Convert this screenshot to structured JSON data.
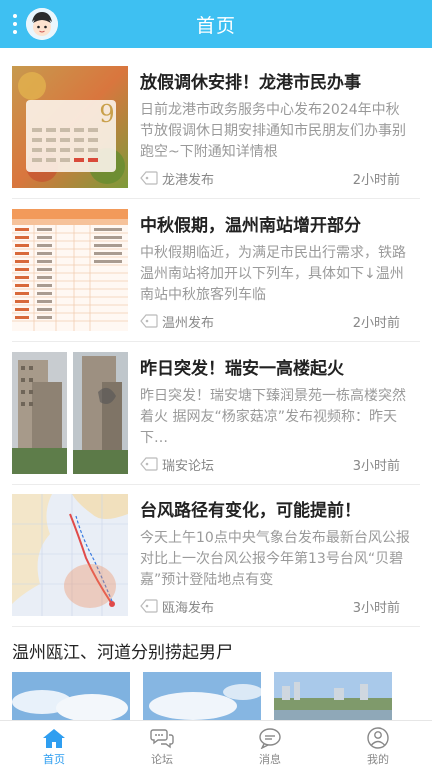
{
  "header": {
    "title": "首页"
  },
  "news": [
    {
      "title": "放假调休安排！龙港市民办事",
      "summary": "日前龙港市政务服务中心发布2024年中秋节放假调休日期安排通知市民朋友们办事别跑空~下附通知详情根",
      "source": "龙港发布",
      "time": "2小时前",
      "thumb": {
        "tag": "9"
      }
    },
    {
      "title": "中秋假期，温州南站增开部分",
      "summary": "中秋假期临近，为满足市民出行需求，铁路温州南站将加开以下列车，具体如下↓温州南站中秋旅客列车临",
      "source": "温州发布",
      "time": "2小时前"
    },
    {
      "title": "昨日突发！瑞安一高楼起火",
      "summary": "昨日突发！瑞安塘下臻润景苑一栋高楼突然着火 据网友“杨家菇凉”发布视频称：昨天下…",
      "source": "瑞安论坛",
      "time": "3小时前"
    },
    {
      "title": "台风路径有变化，可能提前！",
      "summary": "今天上午10点中央气象台发布最新台风公报对比上一次台风公报今年第13号台风“贝碧嘉”预计登陆地点有变",
      "source": "瓯海发布",
      "time": "3小时前"
    }
  ],
  "video_section": {
    "title": "温州瓯江、河道分别捞起男尸"
  },
  "tabbar": [
    {
      "label": "首页",
      "icon": "home-icon",
      "active": true
    },
    {
      "label": "论坛",
      "icon": "chat-bubbles-icon",
      "active": false
    },
    {
      "label": "消息",
      "icon": "message-icon",
      "active": false
    },
    {
      "label": "我的",
      "icon": "user-icon",
      "active": false
    }
  ],
  "colors": {
    "header": "#3ec0f2",
    "active_tab": "#2f9ef0",
    "secondary_text": "#9a9a9a"
  }
}
